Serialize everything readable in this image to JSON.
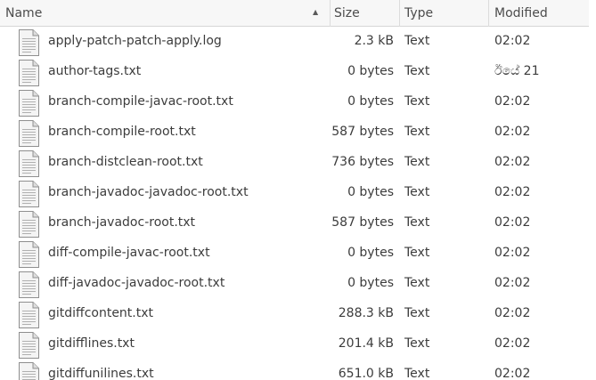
{
  "columns": {
    "name": "Name",
    "size": "Size",
    "type": "Type",
    "modified": "Modified"
  },
  "sort_indicator": "▲",
  "icon": "text-file-icon",
  "files": [
    {
      "name": "apply-patch-patch-apply.log",
      "size": "2.3 kB",
      "type": "Text",
      "modified": "02:02"
    },
    {
      "name": "author-tags.txt",
      "size": "0 bytes",
      "type": "Text",
      "modified": "ඊයේ 21"
    },
    {
      "name": "branch-compile-javac-root.txt",
      "size": "0 bytes",
      "type": "Text",
      "modified": "02:02"
    },
    {
      "name": "branch-compile-root.txt",
      "size": "587 bytes",
      "type": "Text",
      "modified": "02:02"
    },
    {
      "name": "branch-distclean-root.txt",
      "size": "736 bytes",
      "type": "Text",
      "modified": "02:02"
    },
    {
      "name": "branch-javadoc-javadoc-root.txt",
      "size": "0 bytes",
      "type": "Text",
      "modified": "02:02"
    },
    {
      "name": "branch-javadoc-root.txt",
      "size": "587 bytes",
      "type": "Text",
      "modified": "02:02"
    },
    {
      "name": "diff-compile-javac-root.txt",
      "size": "0 bytes",
      "type": "Text",
      "modified": "02:02"
    },
    {
      "name": "diff-javadoc-javadoc-root.txt",
      "size": "0 bytes",
      "type": "Text",
      "modified": "02:02"
    },
    {
      "name": "gitdiffcontent.txt",
      "size": "288.3 kB",
      "type": "Text",
      "modified": "02:02"
    },
    {
      "name": "gitdifflines.txt",
      "size": "201.4 kB",
      "type": "Text",
      "modified": "02:02"
    },
    {
      "name": "gitdiffunilines.txt",
      "size": "651.0 kB",
      "type": "Text",
      "modified": "02:02"
    }
  ]
}
